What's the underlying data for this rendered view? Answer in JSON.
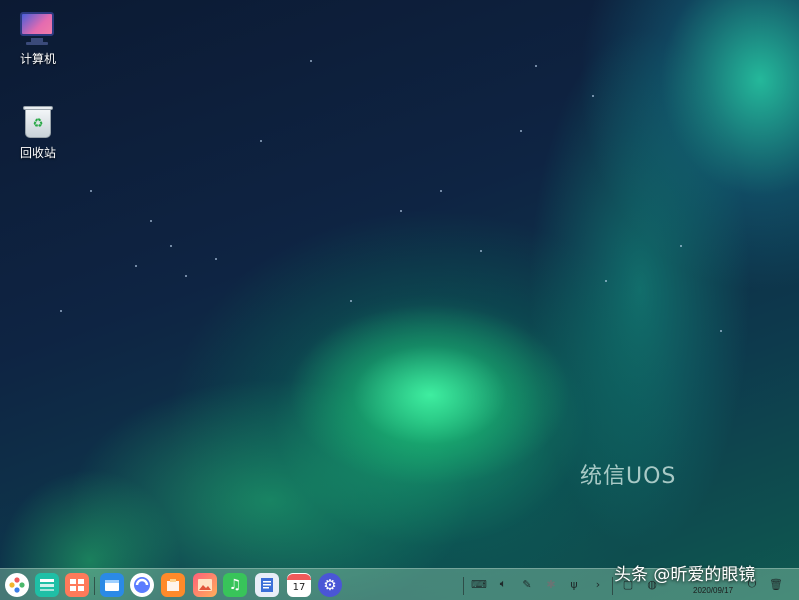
{
  "desktop": {
    "icons": [
      {
        "label": "计算机",
        "icon": "computer-icon"
      },
      {
        "label": "回收站",
        "icon": "trash-icon"
      }
    ],
    "brand_text": "统信UOS"
  },
  "watermark": "头条 @昕爱的眼镜",
  "dock": {
    "apps": [
      {
        "name": "launcher",
        "icon": "launcher-icon",
        "color": "#ffffff"
      },
      {
        "name": "multitasking",
        "icon": "multitask-view-icon",
        "color": "#1fbfa6"
      },
      {
        "name": "workspace",
        "icon": "desktop-view-icon",
        "color": "#ff7a5a"
      },
      {
        "name": "file-manager",
        "icon": "file-manager-icon",
        "color": "#2b8ae6"
      },
      {
        "name": "browser",
        "icon": "browser-icon",
        "color": "#5b7cff"
      },
      {
        "name": "app-store",
        "icon": "app-store-icon",
        "color": "#ff8a2a"
      },
      {
        "name": "photos",
        "icon": "photos-icon",
        "color": "#ff5f7a"
      },
      {
        "name": "music",
        "icon": "music-icon",
        "color": "#38c45a"
      },
      {
        "name": "document-viewer",
        "icon": "document-icon",
        "color": "#3b6fd8"
      },
      {
        "name": "calendar",
        "icon": "calendar-icon",
        "color": "#ffffff",
        "day": "17"
      },
      {
        "name": "control-center",
        "icon": "settings-icon",
        "color": "#4a56d6"
      }
    ],
    "tray": {
      "icons": [
        "keyboard-icon",
        "volume-icon",
        "pen-icon",
        "bluetooth-icon",
        "usb-icon",
        "expand-arrow-icon",
        "clipboard-icon",
        "network-icon",
        "power-icon",
        "trash-icon"
      ],
      "date": "2020/09/17"
    }
  }
}
